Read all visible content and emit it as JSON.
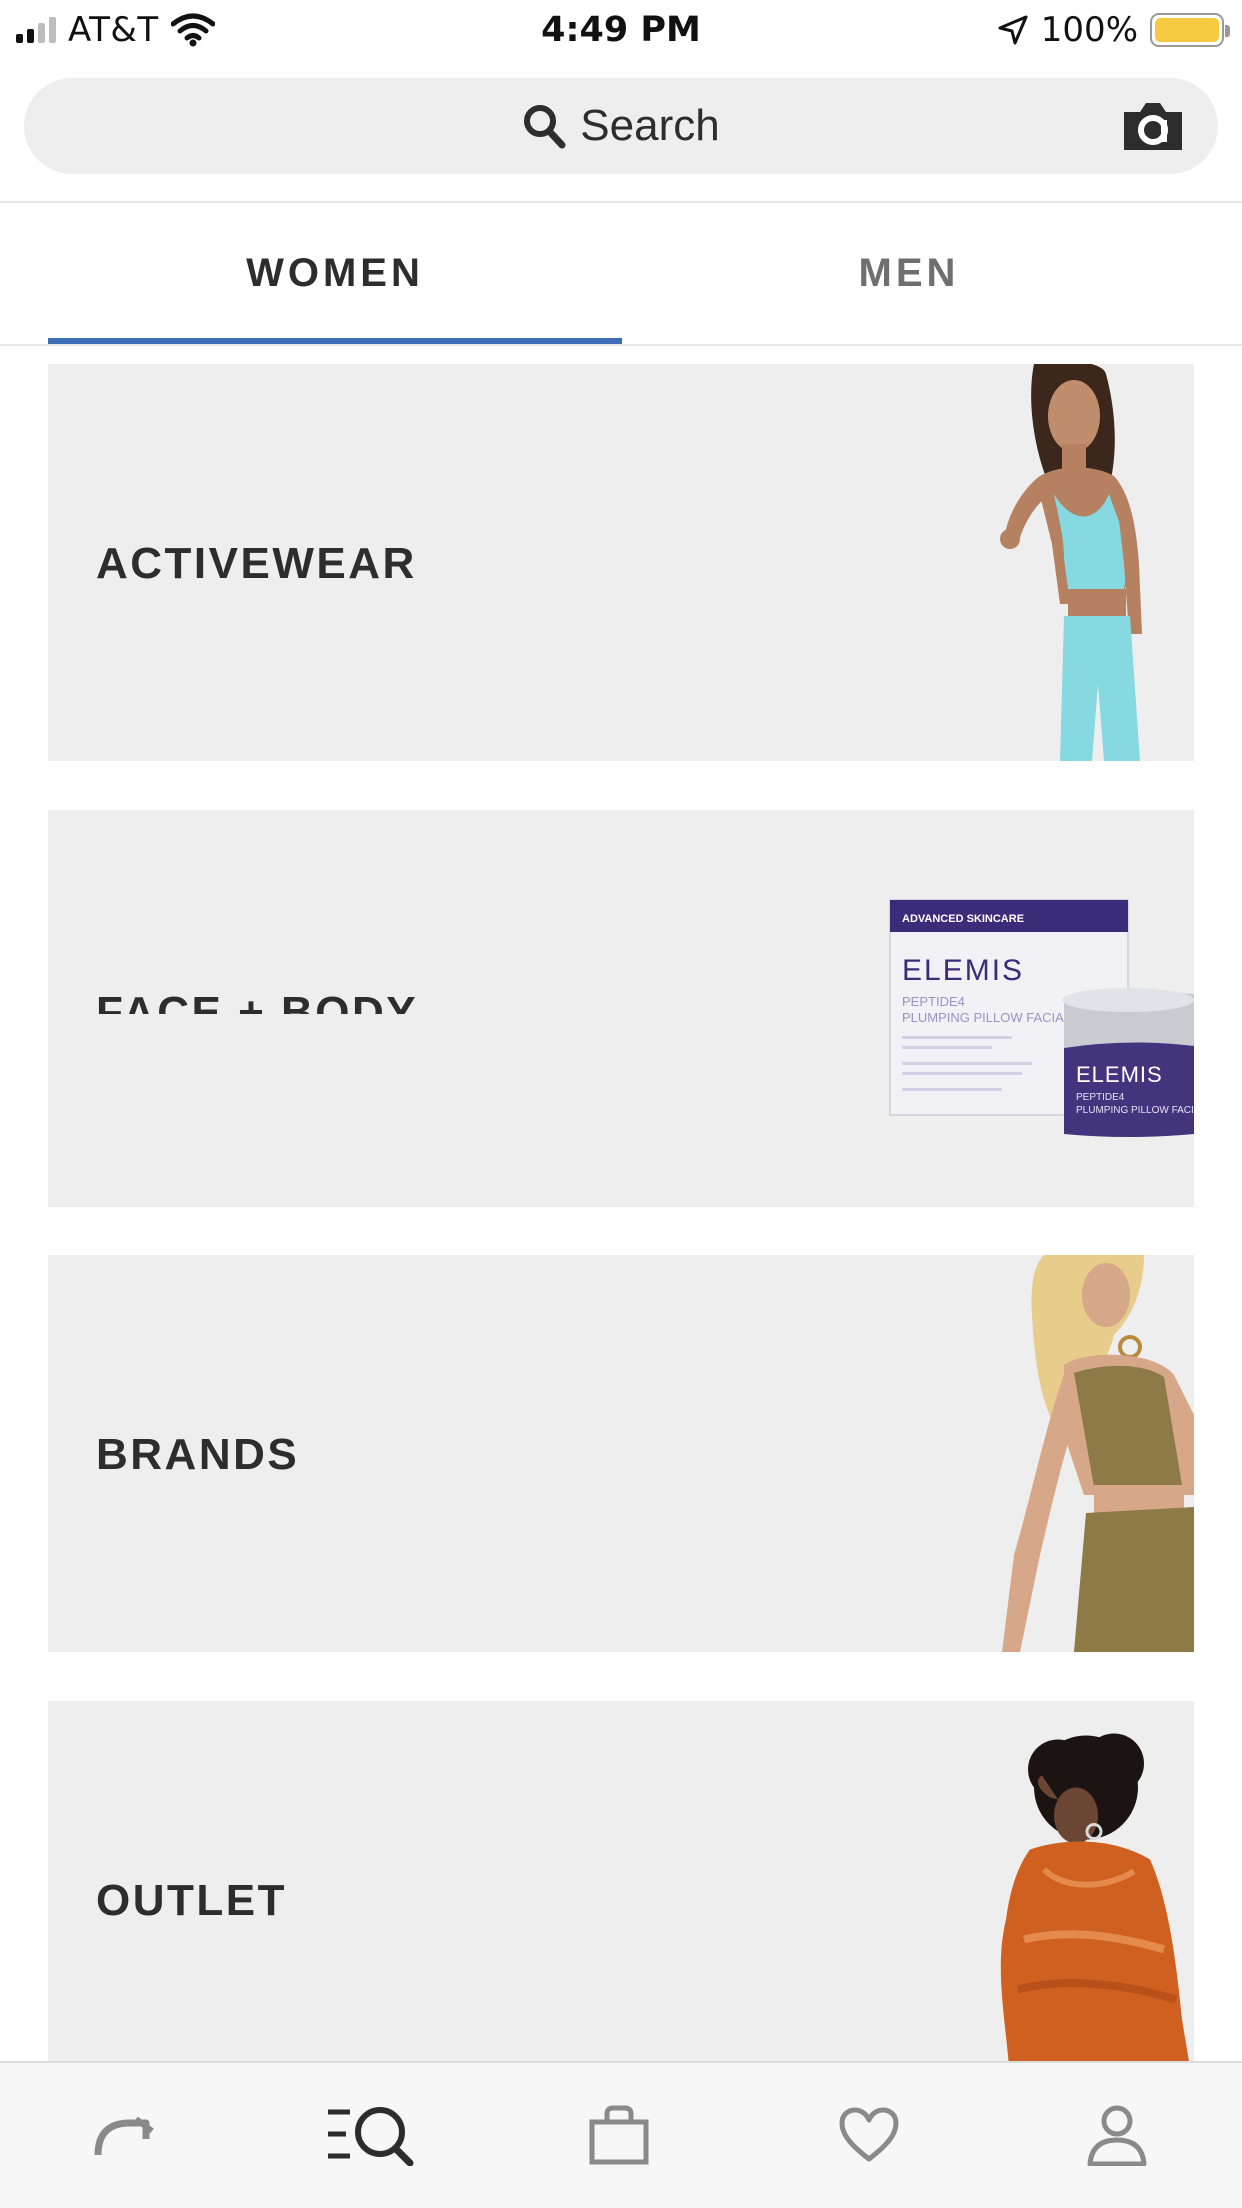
{
  "status_bar": {
    "carrier": "AT&T",
    "time": "4:49 PM",
    "battery_percent": "100%",
    "battery_level": 1.0,
    "battery_color": "#f5c940"
  },
  "search": {
    "placeholder": "Search",
    "search_icon": "search-icon",
    "camera_icon": "camera-icon"
  },
  "tabs": [
    {
      "label": "WOMEN",
      "selected": true
    },
    {
      "label": "MEN",
      "selected": false
    }
  ],
  "accent_color": "#3c6db5",
  "categories": [
    {
      "label": "ACTIVEWEAR",
      "image": "model in turquoise sports bra and leggings"
    },
    {
      "label": "FACE + BODY",
      "image": "Elemis skincare box and jar"
    },
    {
      "label": "BRANDS",
      "image": "model in khaki crop top and skirt"
    },
    {
      "label": "OUTLET",
      "image": "model in orange ruffled dress"
    }
  ],
  "product_packaging": {
    "band_text": "ADVANCED SKINCARE",
    "brand": "ELEMIS",
    "product_line1": "PEPTIDE4",
    "product_line2": "PLUMPING PILLOW FACIAL"
  },
  "bottom_nav": [
    {
      "icon": "home-icon",
      "selected": false
    },
    {
      "icon": "browse-search-icon",
      "selected": true
    },
    {
      "icon": "bag-icon",
      "selected": false
    },
    {
      "icon": "heart-icon",
      "selected": false
    },
    {
      "icon": "account-icon",
      "selected": false
    }
  ]
}
